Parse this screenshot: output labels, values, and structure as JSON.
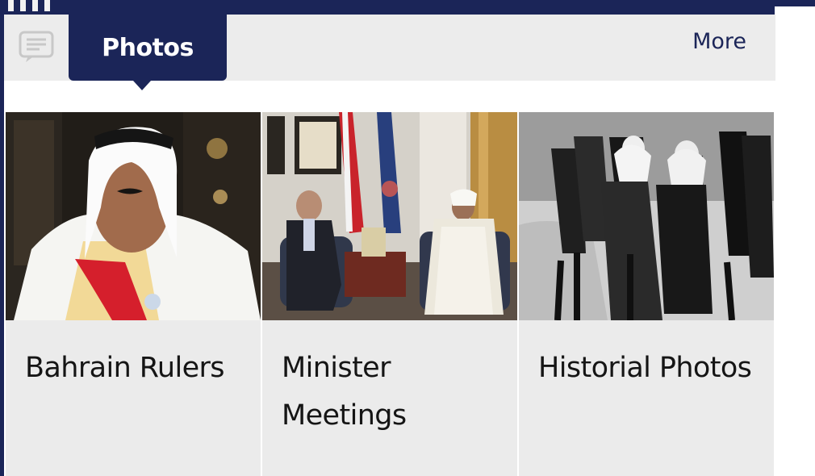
{
  "header": {
    "chat_icon": "chat-bubble-icon",
    "active_tab_label": "Photos",
    "more_label": "More"
  },
  "cards": [
    {
      "title": "Bahrain Rulers",
      "image": "portrait-photo-ruler"
    },
    {
      "title": "Minister Meetings",
      "image": "meeting-photo-flags"
    },
    {
      "title": "Historial Photos",
      "image": "black-and-white-historical-photo"
    }
  ],
  "colors": {
    "navy": "#1b2558",
    "header_gray": "#ececec",
    "card_gray": "#ebebeb",
    "text_dark": "#151515"
  }
}
